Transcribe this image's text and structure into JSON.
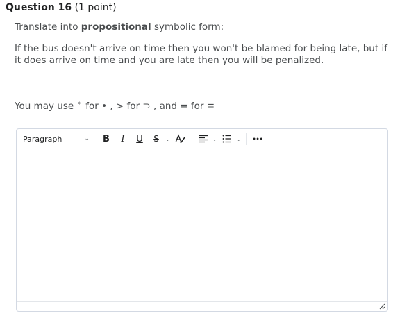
{
  "question": {
    "label": "Question 16",
    "points": "(1 point)"
  },
  "instruction": {
    "prefix": "Translate into ",
    "bold": "propositional",
    "suffix": " symbolic form:"
  },
  "sentence": "If the bus doesn't arrive on time then you won't be blamed for being late, but if it does arrive on time and you are late then you will be penalized.",
  "hint": {
    "lead": "You may use",
    "star": "*",
    "rest": "for • , > for ⊃ ,  and = for ≡"
  },
  "editor": {
    "block_format": "Paragraph",
    "bold_label": "B",
    "italic_label": "I",
    "underline_label": "U",
    "strike_label": "S",
    "more_label": "•••"
  }
}
